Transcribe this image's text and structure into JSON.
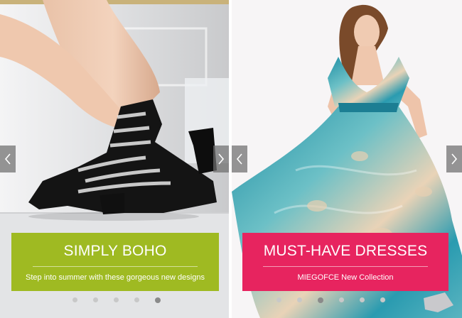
{
  "slides": [
    {
      "title": "SIMPLY BOHO",
      "subtitle": "Step into summer with these gorgeous new designs",
      "accent": "#9fba22",
      "image": "black-gladiator-sandals-photo",
      "dots_total": 5,
      "dots_active_index": 4
    },
    {
      "title": "MUST-HAVE DRESSES",
      "subtitle": "MIEGOFCE New Collection",
      "accent": "#e7245f",
      "image": "floral-maxi-dress-model-photo",
      "dots_total": 6,
      "dots_active_index": 2
    }
  ],
  "controls": {
    "prev_icon": "chevron-left-icon",
    "next_icon": "chevron-right-icon"
  }
}
